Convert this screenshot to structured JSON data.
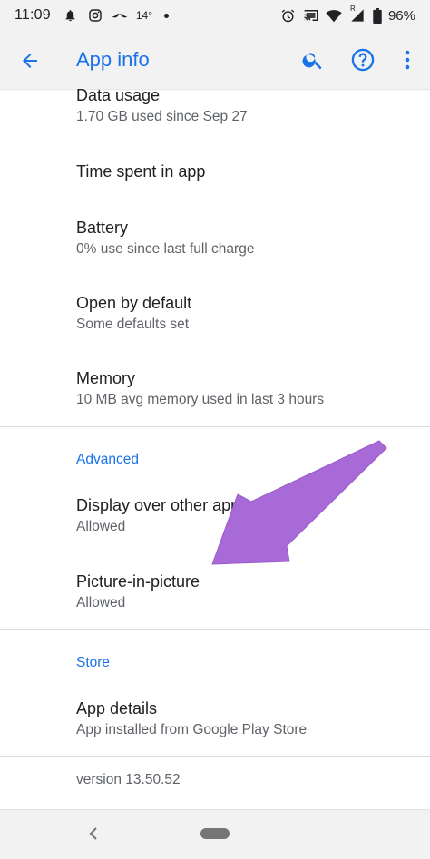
{
  "status_bar": {
    "time": "11:09",
    "temperature": "14°",
    "battery_text": "96%",
    "signal_badge": "R"
  },
  "app_bar": {
    "title": "App info"
  },
  "items": [
    {
      "title": "Data usage",
      "summary": "1.70 GB used since Sep 27"
    },
    {
      "title": "Time spent in app",
      "summary": ""
    },
    {
      "title": "Battery",
      "summary": "0% use since last full charge"
    },
    {
      "title": "Open by default",
      "summary": "Some defaults set"
    },
    {
      "title": "Memory",
      "summary": "10 MB avg memory used in last 3 hours"
    }
  ],
  "advanced": {
    "header": "Advanced",
    "items": [
      {
        "title": "Display over other apps",
        "summary": "Allowed"
      },
      {
        "title": "Picture-in-picture",
        "summary": "Allowed"
      }
    ]
  },
  "store": {
    "header": "Store",
    "items": [
      {
        "title": "App details",
        "summary": "App installed from Google Play Store"
      }
    ]
  },
  "version": "version 13.50.52",
  "colors": {
    "accent": "#1a73e8",
    "annotation_arrow": "#a86ad6"
  }
}
